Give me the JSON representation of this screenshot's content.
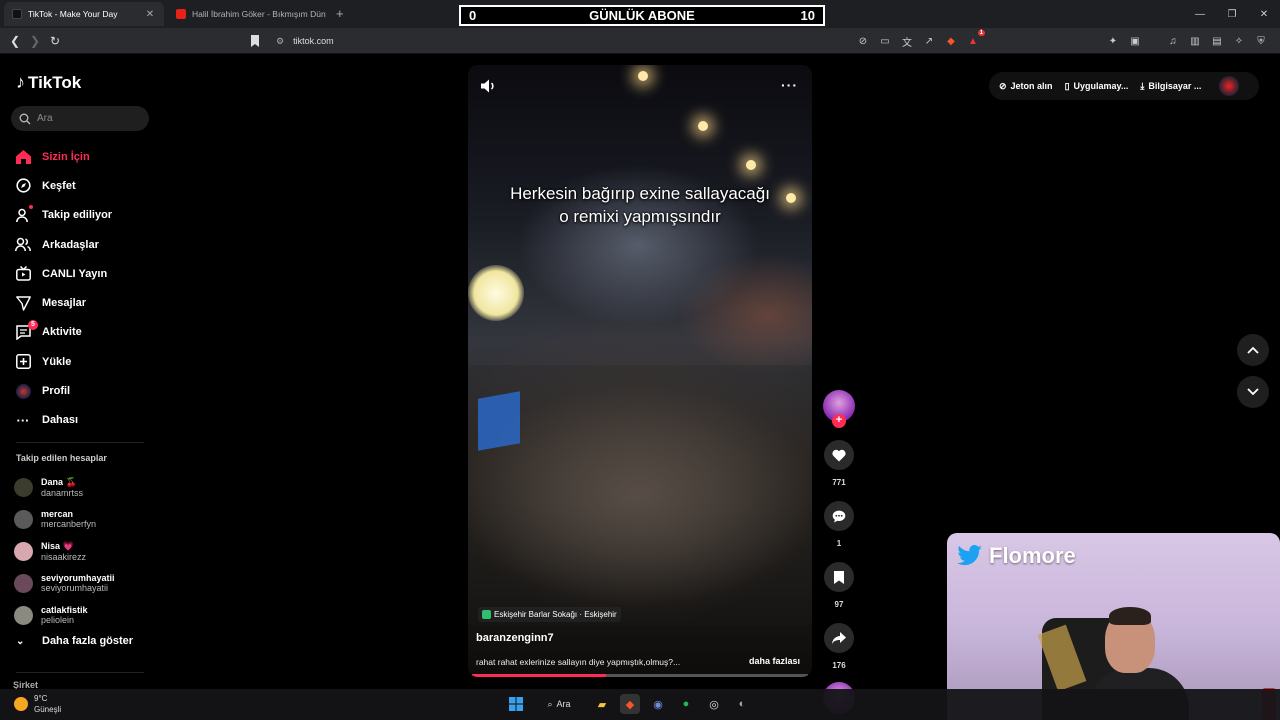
{
  "browser": {
    "tabs": [
      {
        "title": "TikTok - Make Your Day",
        "active": true
      },
      {
        "title": "Halil İbrahim Göker - Bıkmışım Dünya",
        "active": false
      }
    ],
    "url": "tiktok.com",
    "extension_badge": "1"
  },
  "stream_counter": {
    "left": "0",
    "label": "GÜNLÜK ABONE",
    "right": "10"
  },
  "sidebar": {
    "logo": "TikTok",
    "search_placeholder": "Ara",
    "menu": [
      {
        "label": "Sizin İçin",
        "icon": "home-icon",
        "active": true
      },
      {
        "label": "Keşfet",
        "icon": "compass-icon"
      },
      {
        "label": "Takip ediliyor",
        "icon": "following-icon"
      },
      {
        "label": "Arkadaşlar",
        "icon": "friends-icon"
      },
      {
        "label": "CANLI Yayın",
        "icon": "live-icon"
      },
      {
        "label": "Mesajlar",
        "icon": "message-icon"
      },
      {
        "label": "Aktivite",
        "icon": "activity-icon",
        "badge": "5"
      },
      {
        "label": "Yükle",
        "icon": "upload-icon"
      },
      {
        "label": "Profil",
        "icon": "profile-icon"
      },
      {
        "label": "Dahası",
        "icon": "more-icon"
      }
    ],
    "following_title": "Takip edilen hesaplar",
    "following": [
      {
        "name": "Dana 🍒",
        "handle": "danamrtss",
        "color": "#3b3b2e"
      },
      {
        "name": "mercan",
        "handle": "mercanberfyn",
        "color": "#5a5a5a"
      },
      {
        "name": "Nisa 💗",
        "handle": "nisaakirezz",
        "color": "#d8a8b0"
      },
      {
        "name": "seviyorumhayatii",
        "handle": "seviyorumhayatii",
        "color": "#6a4a5a"
      },
      {
        "name": "catlakfistik",
        "handle": "peliolein",
        "color": "#8a8a80"
      }
    ],
    "show_more": "Daha fazla göster",
    "footer": "Şirket"
  },
  "video": {
    "caption_line1": "Herkesin bağırıp exine sallayacağı",
    "caption_line2": "o remixi yapmışsındır",
    "location": "Eskişehir Barlar Sokağı · Eskişehir",
    "author": "baranzenginn7",
    "description": "rahat rahat exlerinize sallayın diye yapmıştık,olmuş?...",
    "more_label": "daha fazlası",
    "progress": 0.4
  },
  "actions": {
    "likes": "771",
    "comments": "1",
    "saves": "97",
    "shares": "176"
  },
  "topbar": {
    "coins": "Jeton alın",
    "app": "Uygulamay...",
    "desktop": "Bilgisayar ..."
  },
  "webcam": {
    "brand": "Flomore"
  },
  "taskbar": {
    "temperature": "9°C",
    "weather": "Güneşli",
    "search": "Ara"
  },
  "colors": {
    "accent": "#fe2c55",
    "background": "#000000"
  }
}
